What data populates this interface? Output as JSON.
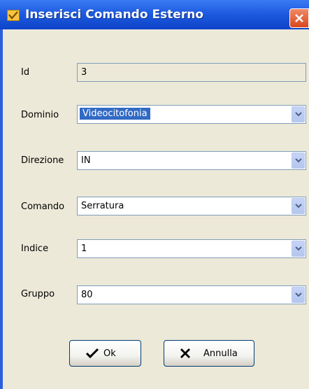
{
  "window": {
    "title": "Inserisci Comando Esterno",
    "icon": "app-window-icon"
  },
  "form": {
    "id": {
      "label": "Id",
      "value": "3"
    },
    "dominio": {
      "label": "Dominio",
      "value": "Videocitofonia"
    },
    "direzione": {
      "label": "Direzione",
      "value": "IN"
    },
    "comando": {
      "label": "Comando",
      "value": "Serratura"
    },
    "indice": {
      "label": "Indice",
      "value": "1"
    },
    "gruppo": {
      "label": "Gruppo",
      "value": "80"
    }
  },
  "buttons": {
    "ok": {
      "label": "Ok",
      "icon": "checkmark-icon"
    },
    "annulla": {
      "label": "Annulla",
      "icon": "x-icon"
    }
  }
}
